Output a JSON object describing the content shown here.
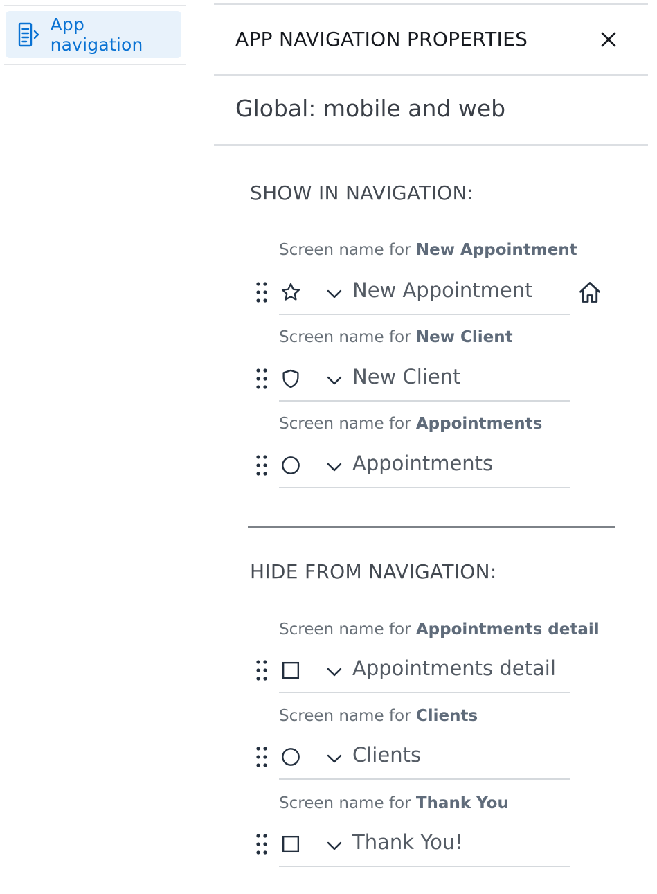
{
  "sidebar": {
    "app_navigation_label": "App navigation",
    "app_navigation_icon": "list-arrow-icon"
  },
  "panel": {
    "title": "APP NAVIGATION PROPERTIES",
    "close_icon": "close-icon",
    "scope": "Global: mobile and web"
  },
  "show_section": {
    "title": "SHOW IN NAVIGATION:",
    "items": [
      {
        "hint_prefix": "Screen name for ",
        "hint_target": "New Appointment",
        "name": "New Appointment",
        "icon": "star-icon",
        "home": true
      },
      {
        "hint_prefix": "Screen name for ",
        "hint_target": "New Client",
        "name": "New Client",
        "icon": "shield-icon",
        "home": false
      },
      {
        "hint_prefix": "Screen name for ",
        "hint_target": "Appointments",
        "name": "Appointments",
        "icon": "circle-icon",
        "home": false
      }
    ]
  },
  "hide_section": {
    "title": "HIDE FROM NAVIGATION:",
    "items": [
      {
        "hint_prefix": "Screen name for ",
        "hint_target": "Appointments detail",
        "name": "Appointments detail",
        "icon": "square-icon"
      },
      {
        "hint_prefix": "Screen name for ",
        "hint_target": "Clients",
        "name": "Clients",
        "icon": "circle-icon"
      },
      {
        "hint_prefix": "Screen name for ",
        "hint_target": "Thank You",
        "name": "Thank You!",
        "icon": "square-icon"
      }
    ]
  },
  "colors": {
    "accent": "#0972d3",
    "sidebar_highlight": "#e8f2fb"
  }
}
